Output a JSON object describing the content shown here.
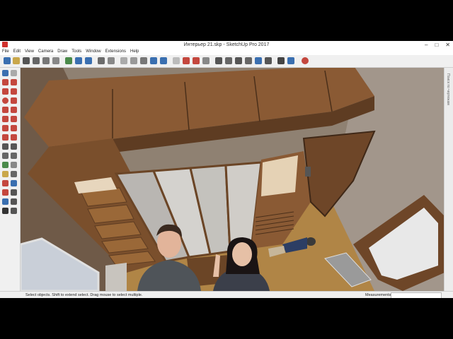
{
  "window": {
    "title": "Интерьер 21.skp - SketchUp Pro 2017",
    "controls": {
      "minimize": "–",
      "maximize": "□",
      "close": "✕"
    }
  },
  "menu": [
    "File",
    "Edit",
    "View",
    "Camera",
    "Draw",
    "Tools",
    "Window",
    "Extensions",
    "Help"
  ],
  "toolbar_icons": [
    "select-icon",
    "paint-icon",
    "home-icon",
    "house-icon",
    "house-icon",
    "house-icon",
    "orbit-icon",
    "pan-icon",
    "zoom-icon",
    "iso-view-icon",
    "top-view-icon",
    "front-view-icon",
    "right-view-icon",
    "back-view-icon",
    "left-view-icon",
    "box-icon",
    "xray-icon",
    "wireframe-icon",
    "hidden-line-icon",
    "shaded-icon",
    "textured-icon",
    "monochrome-icon",
    "undo-icon",
    "warehouse-icon",
    "extension-icon",
    "share-icon",
    "component-icon",
    "camera-icon",
    "camera-icon",
    "section-icon",
    "section-icon",
    "section-icon",
    "walk-icon",
    "look-icon",
    "position-camera-icon",
    "scenes-icon",
    "layers-icon",
    "tape-icon"
  ],
  "colors": {
    "window_bg": "#f0f0f0",
    "wood_dark": "#5e3c22",
    "wood_mid": "#8a5a34",
    "wood_light": "#a9763f",
    "floor": "#b08546",
    "wall": "#9a8b7c",
    "glass": "#c6cbcf"
  },
  "right_panel": {
    "label": "Поиск по чертежам"
  },
  "status": {
    "hint": "Select objects. Shift to extend select. Drag mouse to select multiple.",
    "measurements_label": "Measurements",
    "measurements_value": ""
  }
}
